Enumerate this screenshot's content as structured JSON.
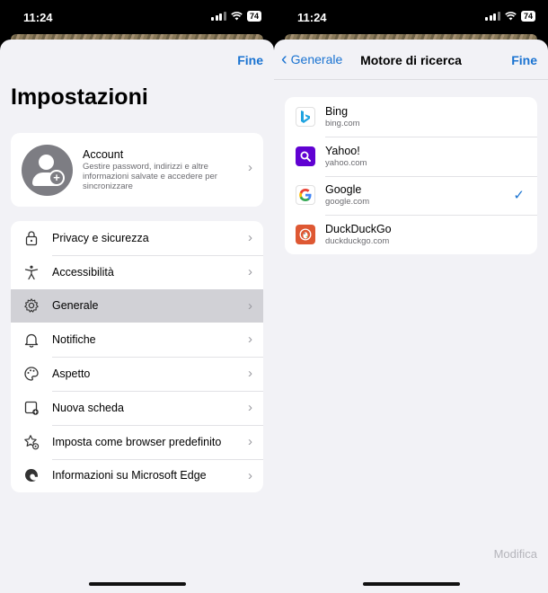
{
  "left": {
    "status": {
      "time": "11:24",
      "battery": "74"
    },
    "done_label": "Fine",
    "title": "Impostazioni",
    "account": {
      "title": "Account",
      "description": "Gestire password, indirizzi e altre informazioni salvate e accedere per sincronizzare"
    },
    "menu": [
      {
        "label": "Privacy e sicurezza",
        "icon": "lock-icon"
      },
      {
        "label": "Accessibilità",
        "icon": "accessibility-icon"
      },
      {
        "label": "Generale",
        "icon": "gear-icon",
        "selected": true
      },
      {
        "label": "Notifiche",
        "icon": "bell-icon"
      },
      {
        "label": "Aspetto",
        "icon": "palette-icon"
      },
      {
        "label": "Nuova scheda",
        "icon": "new-tab-icon"
      },
      {
        "label": "Imposta come browser predefinito",
        "icon": "star-gear-icon"
      },
      {
        "label": "Informazioni su Microsoft Edge",
        "icon": "edge-icon"
      }
    ]
  },
  "right": {
    "status": {
      "time": "11:24",
      "battery": "74"
    },
    "back_label": "Generale",
    "title": "Motore di ricerca",
    "done_label": "Fine",
    "engines": [
      {
        "name": "Bing",
        "domain": "bing.com",
        "icon": "bing-logo-icon",
        "selected": false
      },
      {
        "name": "Yahoo!",
        "domain": "yahoo.com",
        "icon": "yahoo-logo-icon",
        "selected": false
      },
      {
        "name": "Google",
        "domain": "google.com",
        "icon": "google-logo-icon",
        "selected": true
      },
      {
        "name": "DuckDuckGo",
        "domain": "duckduckgo.com",
        "icon": "duckduckgo-logo-icon",
        "selected": false
      }
    ],
    "edit_label": "Modifica"
  },
  "colors": {
    "accent": "#1a73d1",
    "background": "#f2f2f6",
    "selected_row": "#d1d1d6"
  }
}
